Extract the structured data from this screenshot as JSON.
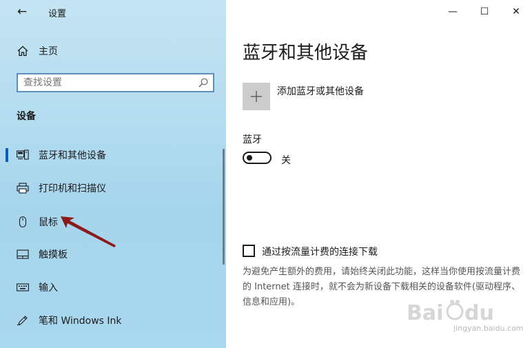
{
  "window": {
    "title": "设置",
    "minimize_glyph": "—",
    "maximize_glyph": "☐",
    "close_glyph": "✕"
  },
  "sidebar": {
    "back_glyph": "←",
    "home_label": "主页",
    "search_placeholder": "查找设置",
    "section_title": "设备",
    "items": [
      {
        "label": "蓝牙和其他设备",
        "icon": "bluetooth-devices-icon",
        "active": true
      },
      {
        "label": "打印机和扫描仪",
        "icon": "printer-icon",
        "active": false
      },
      {
        "label": "鼠标",
        "icon": "mouse-icon",
        "active": false
      },
      {
        "label": "触摸板",
        "icon": "touchpad-icon",
        "active": false
      },
      {
        "label": "输入",
        "icon": "keyboard-icon",
        "active": false
      },
      {
        "label": "笔和 Windows Ink",
        "icon": "pen-icon",
        "active": false
      }
    ]
  },
  "main": {
    "page_title": "蓝牙和其他设备",
    "add_device_label": "添加蓝牙或其他设备",
    "bluetooth_label": "蓝牙",
    "bluetooth_state": "关",
    "metered_checkbox_label": "通过按流量计费的连接下载",
    "metered_description": "为避免产生额外的费用，请始终关闭此功能，这样当你使用按流量计费的 Internet 连接时，就不会为新设备下载相关的设备软件(驱动程序、信息和应用)。"
  },
  "watermark": {
    "text": "jingyan.baidu.com"
  },
  "colors": {
    "accent": "#0a5fb4",
    "arrow": "#8b1a1a",
    "sidebar_bg": "#b6ddf0"
  }
}
